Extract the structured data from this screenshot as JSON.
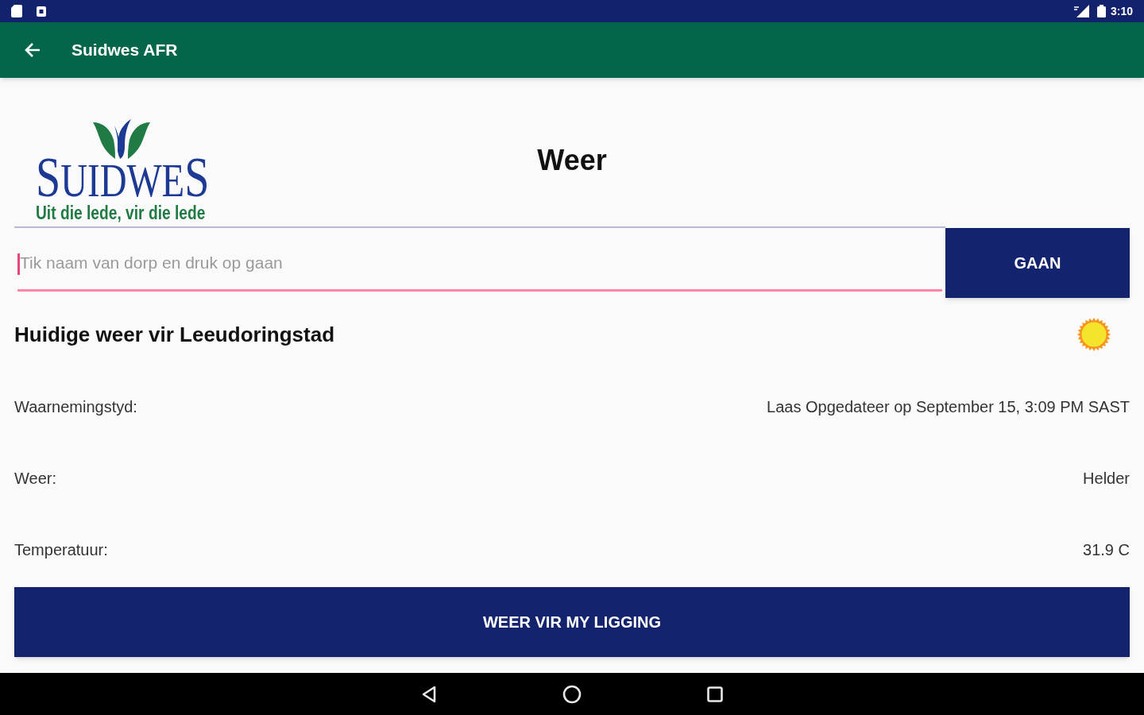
{
  "status_bar": {
    "time": "3:10"
  },
  "app_bar": {
    "title": "Suidwes AFR"
  },
  "header": {
    "logo_name": "SUIDWES",
    "logo_tagline": "Uit die lede, vir die lede",
    "title": "Weer"
  },
  "search": {
    "placeholder": "Tik naam van dorp en druk op gaan",
    "focused": true,
    "button": "GAAN"
  },
  "current_weather": {
    "heading": "Huidige weer vir Leeudoringstad",
    "rows": [
      {
        "label": "Waarnemingstyd:",
        "value": "Laas Opgedateer op September 15, 3:09 PM SAST"
      },
      {
        "label": "Weer:",
        "value": "Helder"
      },
      {
        "label": "Temperatuur:",
        "value": "31.9 C"
      }
    ]
  },
  "location_button": "WEER VIR MY LIGGING"
}
